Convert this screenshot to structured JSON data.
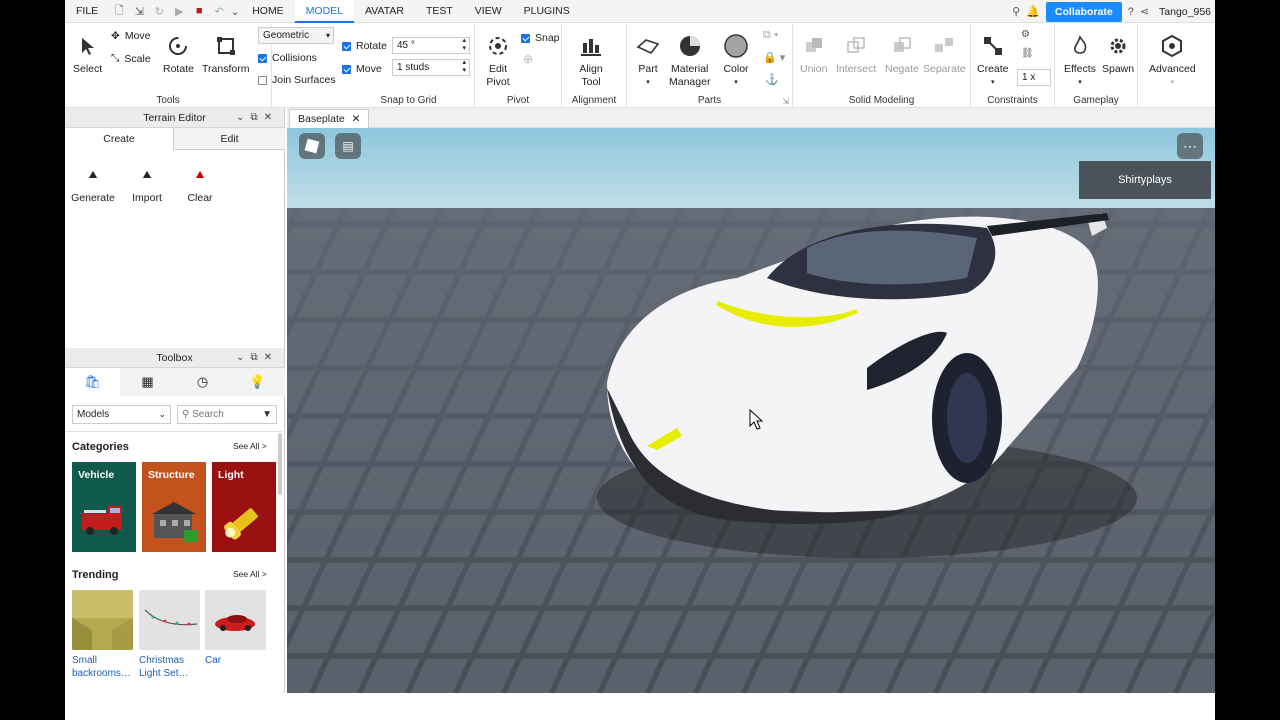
{
  "menubar": {
    "items": [
      "FILE",
      "HOME",
      "MODEL",
      "AVATAR",
      "TEST",
      "VIEW",
      "PLUGINS"
    ],
    "active": "MODEL",
    "collaborate": "Collaborate",
    "username": "Tango_956"
  },
  "ribbon": {
    "tools": {
      "select": "Select",
      "move": "Move",
      "scale": "Scale",
      "rotate": "Rotate",
      "transform": "Transform",
      "title": "Tools"
    },
    "snap": {
      "mode": "Geometric",
      "collisions": "Collisions",
      "join": "Join Surfaces",
      "rotate_label": "Rotate",
      "rotate_value": "45 °",
      "move_label": "Move",
      "move_value": "1 studs",
      "title": "Snap to Grid"
    },
    "pivot": {
      "edit_line1": "Edit",
      "edit_line2": "Pivot",
      "snap": "Snap",
      "title": "Pivot"
    },
    "alignment": {
      "line1": "Align",
      "line2": "Tool",
      "title": "Alignment"
    },
    "parts": {
      "part": "Part",
      "material_line1": "Material",
      "material_line2": "Manager",
      "color": "Color",
      "title": "Parts"
    },
    "solid": {
      "union": "Union",
      "intersect": "Intersect",
      "negate": "Negate",
      "separate": "Separate",
      "title": "Solid Modeling"
    },
    "constraints": {
      "create": "Create",
      "scale": "1 x",
      "title": "Constraints"
    },
    "gameplay": {
      "effects": "Effects",
      "spawn": "Spawn",
      "title": "Gameplay"
    },
    "advanced": "Advanced"
  },
  "terrain": {
    "title": "Terrain Editor",
    "tabs": [
      "Create",
      "Edit"
    ],
    "tools": [
      "Generate",
      "Import",
      "Clear"
    ]
  },
  "toolbox": {
    "title": "Toolbox",
    "dropdown": "Models",
    "search_placeholder": "Search",
    "categories_title": "Categories",
    "see_all": "See All >",
    "categories": [
      "Vehicle",
      "Structure",
      "Light"
    ],
    "trending_title": "Trending",
    "trending": [
      {
        "line1": "Small",
        "line2": "backrooms…"
      },
      {
        "line1": "Christmas",
        "line2": "Light Set…"
      },
      {
        "line1": "Car",
        "line2": ""
      }
    ]
  },
  "doc": {
    "tab": "Baseplate"
  },
  "viewport": {
    "player": "Shirtyplays"
  },
  "colors": {
    "accent": "#1a73e8",
    "collaborate": "#1a8cff",
    "vehicle": "#0f5a4d",
    "structure": "#c4521c",
    "light": "#9b1111",
    "sky": "#a9d3e3",
    "ground": "#4f5763"
  }
}
